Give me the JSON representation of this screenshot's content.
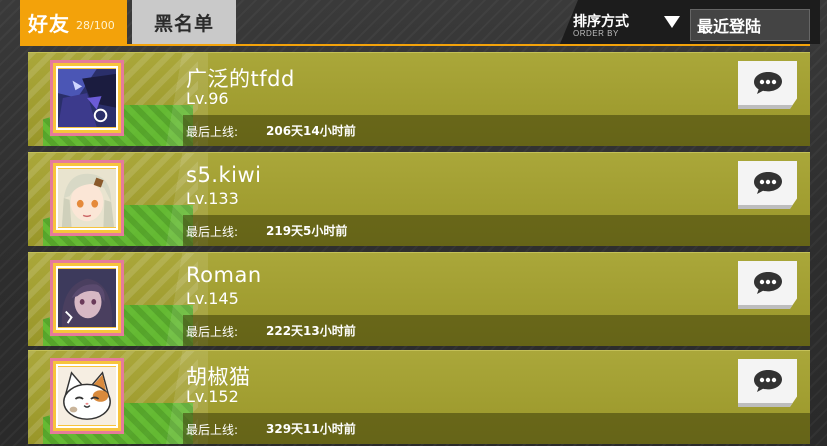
{
  "tabs": {
    "friends_label": "好友",
    "friends_count": "28/100",
    "blacklist_label": "黑名单"
  },
  "sort": {
    "title": "排序方式",
    "subtitle": "ORDER BY",
    "selected": "最近登陆"
  },
  "friends": [
    {
      "name": "广泛的tfdd",
      "level": "Lv.96",
      "last_online_label": "最后上线:",
      "last_online": "206天14小时前",
      "avatar": "dark-armored-character-avatar"
    },
    {
      "name": "s5.kiwi",
      "level": "Lv.133",
      "last_online_label": "最后上线:",
      "last_online": "219天5小时前",
      "avatar": "white-haired-girl-avatar"
    },
    {
      "name": "Roman",
      "level": "Lv.145",
      "last_online_label": "最后上线:",
      "last_online": "222天13小时前",
      "avatar": "dark-haired-girl-avatar"
    },
    {
      "name": "胡椒猫",
      "level": "Lv.152",
      "last_online_label": "最后上线:",
      "last_online": "329天11小时前",
      "avatar": "calico-cat-avatar"
    }
  ],
  "colors": {
    "accent": "#f3a20a",
    "card": "#a5a236",
    "avatar_border": "#e57b9a"
  },
  "icons": {
    "chat": "speech-bubble-icon",
    "sort": "triangle-down-icon"
  }
}
